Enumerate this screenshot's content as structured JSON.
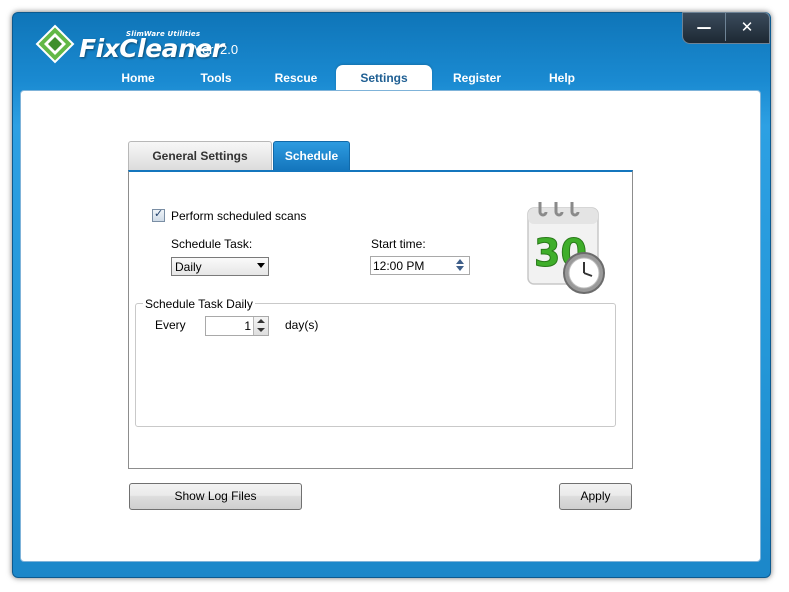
{
  "app": {
    "brand_small": "SlimWare Utilities",
    "brand_name": "FixCleaner",
    "version": "Ver. 2.0",
    "accent_color": "#1c87c9"
  },
  "window_controls": {
    "minimize": "—",
    "close": "✕"
  },
  "nav": {
    "items": [
      {
        "label": "Home"
      },
      {
        "label": "Tools"
      },
      {
        "label": "Rescue"
      },
      {
        "label": "Settings"
      },
      {
        "label": "Register"
      },
      {
        "label": "Help"
      }
    ],
    "active": "Settings"
  },
  "tabs": {
    "general": "General Settings",
    "schedule": "Schedule",
    "active": "Schedule"
  },
  "schedule": {
    "perform_label": "Perform scheduled scans",
    "perform_checked": true,
    "task_label": "Schedule Task:",
    "task_value": "Daily",
    "start_label": "Start time:",
    "start_value": "12:00 PM",
    "group_title": "Schedule Task Daily",
    "every_label": "Every",
    "every_value": "1",
    "days_label": "day(s)",
    "calendar_number": "30"
  },
  "buttons": {
    "show_log": "Show Log Files",
    "apply": "Apply"
  }
}
